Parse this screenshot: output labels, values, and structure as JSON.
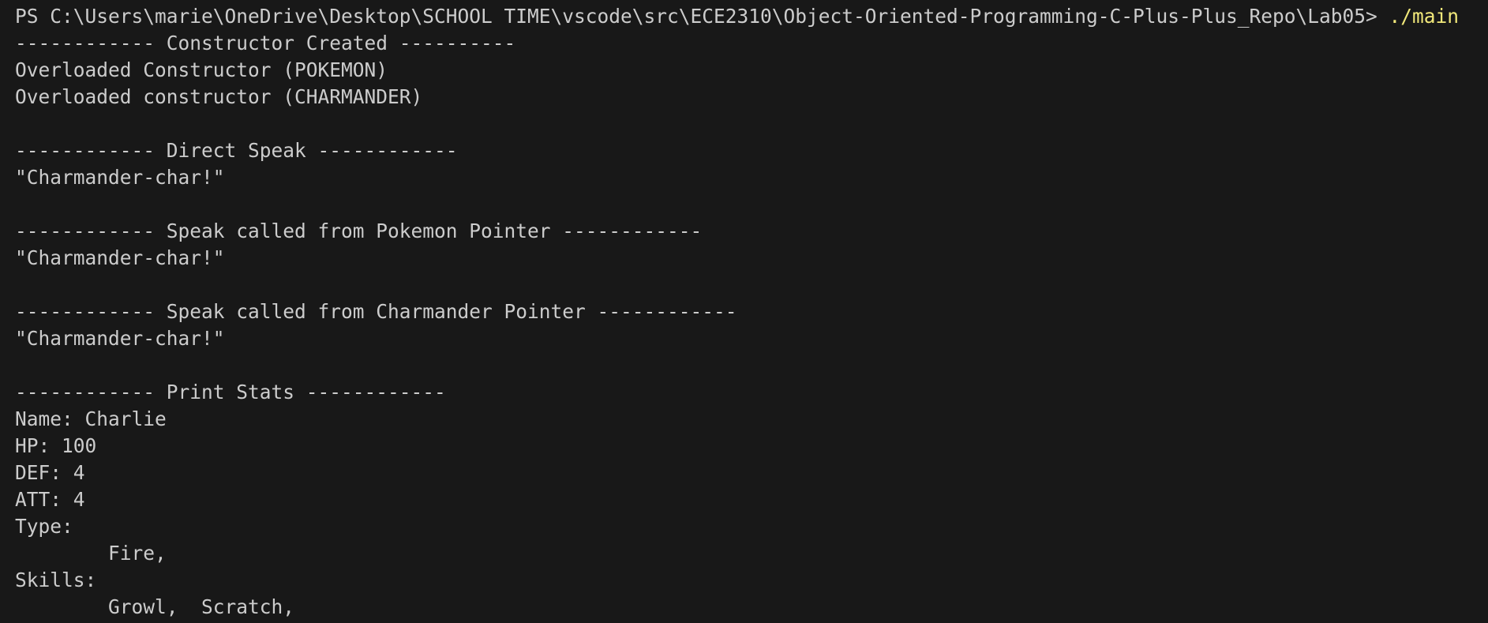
{
  "terminal": {
    "cutoff_text": "                                    ",
    "prompt": "PS C:\\Users\\marie\\OneDrive\\Desktop\\SCHOOL TIME\\vscode\\src\\ECE2310\\Object-Oriented-Programming-C-Plus-Plus_Repo\\Lab05> ",
    "command": "./main",
    "colors": {
      "background": "#181818",
      "text": "#cccccc",
      "command": "#f1e87a"
    },
    "lines": [
      "------------ Constructor Created ----------",
      "Overloaded Constructor (POKEMON)",
      "Overloaded constructor (CHARMANDER)",
      "",
      "------------ Direct Speak ------------",
      "\"Charmander-char!\"",
      "",
      "------------ Speak called from Pokemon Pointer ------------",
      "\"Charmander-char!\"",
      "",
      "------------ Speak called from Charmander Pointer ------------",
      "\"Charmander-char!\"",
      "",
      "------------ Print Stats ------------",
      "Name: Charlie",
      "HP: 100",
      "DEF: 4",
      "ATT: 4",
      "Type:",
      "        Fire,",
      "Skills:",
      "        Growl,  Scratch,"
    ]
  }
}
